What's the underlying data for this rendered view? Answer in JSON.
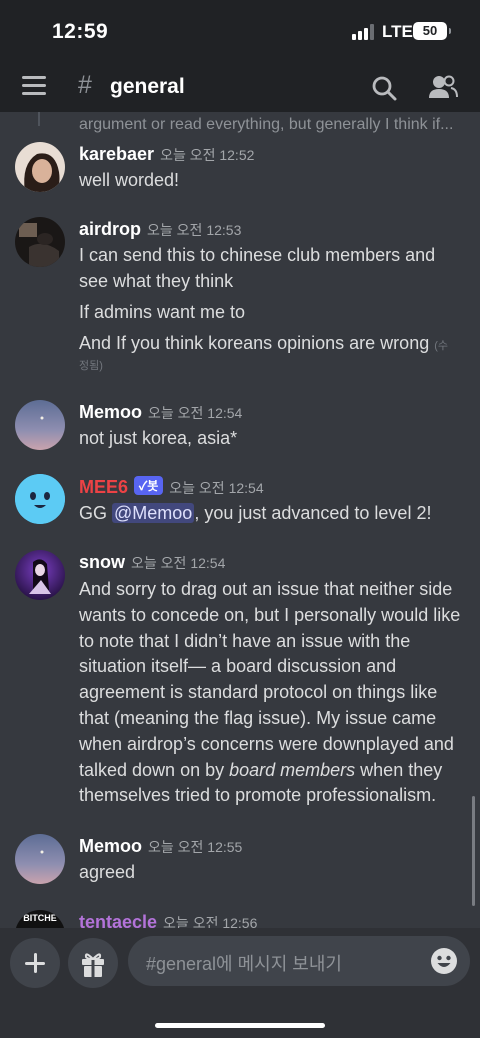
{
  "status_bar": {
    "time": "12:59",
    "network": "LTE",
    "battery": "50"
  },
  "header": {
    "hash": "#",
    "channel": "general"
  },
  "reply_preview": "argument or read everything, but generally I think if...",
  "messages": [
    {
      "username": "karebaer",
      "timestamp": "오늘 오전 12:52",
      "lines": [
        "well worded!"
      ]
    },
    {
      "username": "airdrop",
      "timestamp": "오늘 오전 12:53",
      "lines": [
        "I can send this to chinese club members and",
        "see what they think",
        "If admins want me to",
        "And If you think koreans opinions are wrong"
      ],
      "edited_1": "(수",
      "edited_2": "정됨)"
    },
    {
      "username": "Memoo",
      "timestamp": "오늘 오전 12:54",
      "lines": [
        "not just korea, asia*"
      ]
    },
    {
      "username": "MEE6",
      "bot_tag": "✓봇",
      "timestamp": "오늘 오전 12:54",
      "text_before": "GG ",
      "mention": "@Memoo",
      "text_after": ", you just advanced to level 2!"
    },
    {
      "username": "snow",
      "timestamp": "오늘 오전 12:54",
      "text_1": "And sorry to drag out an issue that neither side wants to concede on, but I personally would like to note that I didn’t have an issue with the situation itself— a board discussion and agreement is standard protocol on things like that (meaning the flag issue). My issue came when airdrop’s concerns were downplayed and talked down on by ",
      "emphasis": "board members",
      "text_2": " when they themselves tried to promote professionalism."
    },
    {
      "username": "Memoo",
      "timestamp": "오늘 오전 12:55",
      "lines": [
        "agreed"
      ]
    },
    {
      "username": "tentaecle",
      "timestamp": "오늘 오전 12:56",
      "avatar_text": "BITCHE"
    }
  ],
  "input": {
    "placeholder": "#general에 메시지 보내기"
  },
  "icons": {
    "menu": "hamburger-menu-icon",
    "search": "search-icon",
    "members": "members-icon",
    "add": "plus-icon",
    "gift": "gift-icon",
    "emoji": "emoji-icon"
  },
  "colors": {
    "background": "#36393f",
    "header": "#202225",
    "mee6_name": "#ed4245",
    "bot_tag": "#5865f2",
    "tentaecle_name": "#b373d9"
  }
}
